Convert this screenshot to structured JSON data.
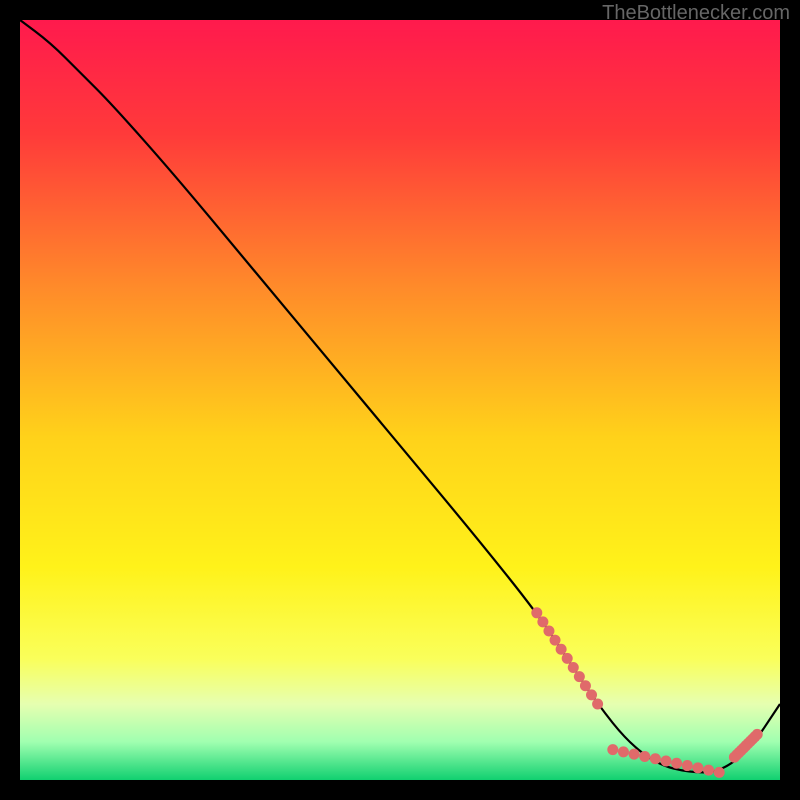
{
  "attribution": "TheBottlenecker.com",
  "chart_data": {
    "type": "line",
    "title": "",
    "xlabel": "",
    "ylabel": "",
    "xlim": [
      0,
      100
    ],
    "ylim": [
      0,
      100
    ],
    "grid": false,
    "legend": false,
    "background_gradient": {
      "stops": [
        {
          "pos": 0.0,
          "color": "#ff1a4d"
        },
        {
          "pos": 0.15,
          "color": "#ff3a3a"
        },
        {
          "pos": 0.35,
          "color": "#ff8a2a"
        },
        {
          "pos": 0.55,
          "color": "#ffd21a"
        },
        {
          "pos": 0.72,
          "color": "#fff21a"
        },
        {
          "pos": 0.84,
          "color": "#faff5a"
        },
        {
          "pos": 0.9,
          "color": "#e6ffb0"
        },
        {
          "pos": 0.95,
          "color": "#a0ffb0"
        },
        {
          "pos": 1.0,
          "color": "#10d070"
        }
      ]
    },
    "series": [
      {
        "name": "bottleneck-curve",
        "x": [
          0,
          4,
          8,
          12,
          20,
          30,
          40,
          50,
          60,
          68,
          72,
          76,
          80,
          84,
          88,
          92,
          96,
          100
        ],
        "y": [
          100,
          97,
          93,
          89,
          80,
          68,
          56,
          44,
          32,
          22,
          16,
          10,
          5,
          2,
          1,
          1,
          4,
          10
        ]
      }
    ],
    "highlight_segments": [
      {
        "name": "descent-highlight",
        "x": [
          68,
          76
        ],
        "y": [
          22,
          10
        ]
      },
      {
        "name": "valley-highlight",
        "x": [
          78,
          92
        ],
        "y": [
          4,
          1
        ]
      },
      {
        "name": "rise-highlight",
        "x": [
          94,
          97
        ],
        "y": [
          3,
          6
        ]
      }
    ],
    "highlight_color": "#e06a6a"
  }
}
